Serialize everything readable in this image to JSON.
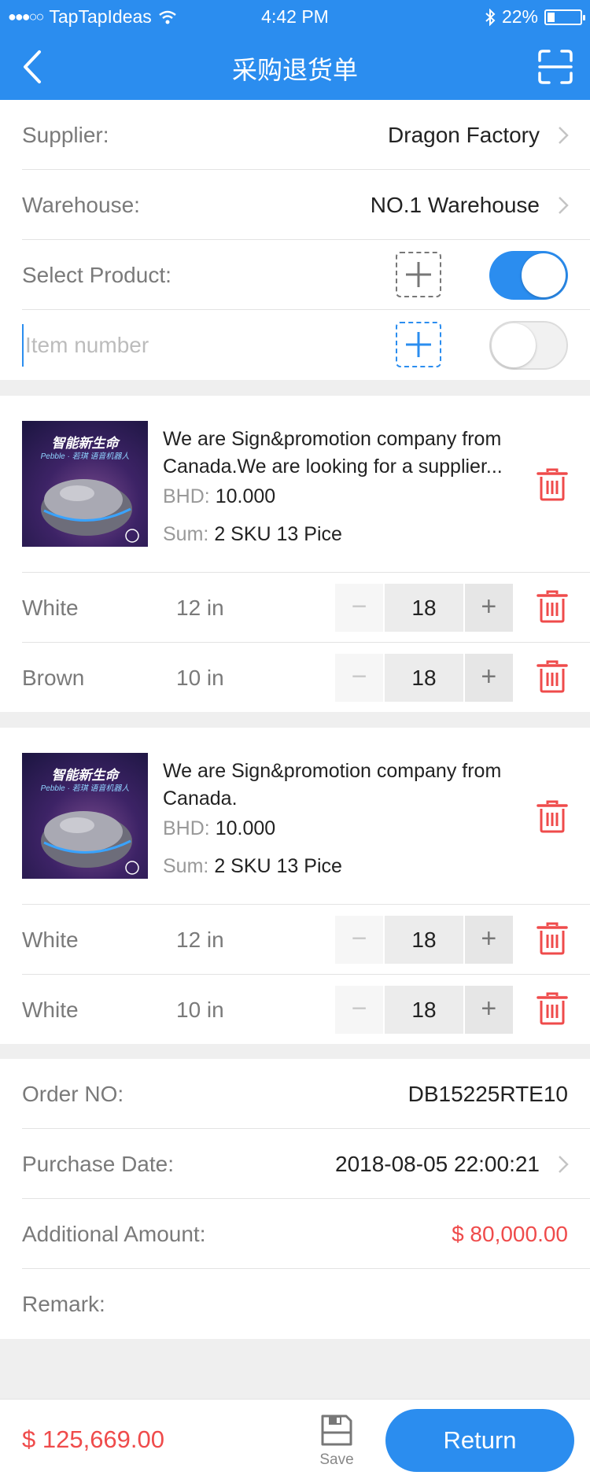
{
  "status_bar": {
    "carrier": "TapTapIdeas",
    "time": "4:42 PM",
    "battery": "22%",
    "battery_level": 0.22
  },
  "nav": {
    "title": "采购退货单"
  },
  "form": {
    "supplier_label": "Supplier:",
    "supplier_value": "Dragon Factory",
    "warehouse_label": "Warehouse:",
    "warehouse_value": "NO.1 Warehouse",
    "select_product_label": "Select Product:",
    "select_product_toggle": true,
    "item_number_placeholder": "Item number",
    "item_number_toggle": false
  },
  "products": [
    {
      "image_text": "智能新生命",
      "image_subtext": "Pebble · 若琪 语音机器人",
      "description": "We are Sign&promotion company from Canada.We are looking for a supplier...",
      "price_label": "BHD:",
      "price": "10.000",
      "sum_label": "Sum:",
      "sum": "2 SKU 13 Pice",
      "skus": [
        {
          "color": "White",
          "size": "12 in",
          "qty": "18"
        },
        {
          "color": "Brown",
          "size": "10 in",
          "qty": "18"
        }
      ]
    },
    {
      "image_text": "智能新生命",
      "image_subtext": "Pebble · 若琪 语音机器人",
      "description": "We are Sign&promotion company from Canada.",
      "price_label": "BHD:",
      "price": "10.000",
      "sum_label": "Sum:",
      "sum": "2 SKU 13 Pice",
      "skus": [
        {
          "color": "White",
          "size": "12 in",
          "qty": "18"
        },
        {
          "color": "White",
          "size": "10 in",
          "qty": "18"
        }
      ]
    }
  ],
  "order": {
    "order_no_label": "Order NO:",
    "order_no": "DB15225RTE10",
    "purchase_date_label": "Purchase Date:",
    "purchase_date": "2018-08-05 22:00:21",
    "additional_amount_label": "Additional Amount:",
    "additional_amount": "$ 80,000.00",
    "remark_label": "Remark:"
  },
  "footer": {
    "total": "$ 125,669.00",
    "save_label": "Save",
    "return_label": "Return"
  },
  "colors": {
    "primary": "#2b8def",
    "danger": "#ef4b4b"
  }
}
